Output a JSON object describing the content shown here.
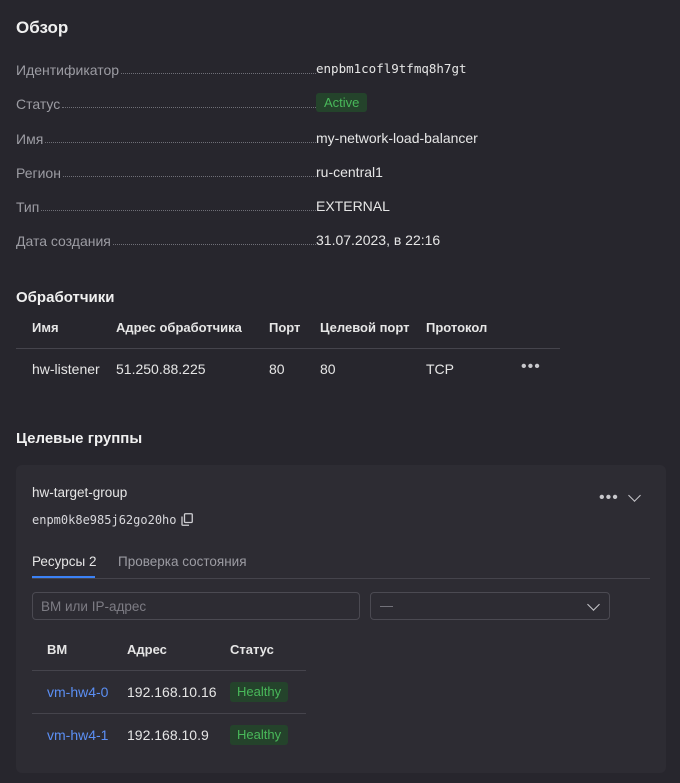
{
  "overview": {
    "title": "Обзор",
    "fields": [
      {
        "key": "Идентификатор",
        "value": "enpbm1cofl9tfmq8h7gt"
      },
      {
        "key": "Статус",
        "value": "Active"
      },
      {
        "key": "Имя",
        "value": "my-network-load-balancer"
      },
      {
        "key": "Регион",
        "value": "ru-central1"
      },
      {
        "key": "Тип",
        "value": "EXTERNAL"
      },
      {
        "key": "Дата создания",
        "value": "31.07.2023, в 22:16"
      }
    ]
  },
  "listeners": {
    "title": "Обработчики",
    "columns": [
      "Имя",
      "Адрес обработчика",
      "Порт",
      "Целевой порт",
      "Протокол"
    ],
    "rows": [
      {
        "name": "hw-listener",
        "address": "51.250.88.225",
        "port": "80",
        "target_port": "80",
        "protocol": "TCP"
      }
    ]
  },
  "target_groups": {
    "title": "Целевые группы",
    "group": {
      "name": "hw-target-group",
      "id": "enpm0k8e985j62go20ho",
      "tabs": [
        {
          "label": "Ресурсы 2",
          "active": true
        },
        {
          "label": "Проверка состояния",
          "active": false
        }
      ],
      "search_placeholder": "ВМ или IP-адрес",
      "status_filter": "—",
      "columns": [
        "ВМ",
        "Адрес",
        "Статус"
      ],
      "rows": [
        {
          "vm": "vm-hw4-0",
          "address": "192.168.10.16",
          "status": "Healthy"
        },
        {
          "vm": "vm-hw4-1",
          "address": "192.168.10.9",
          "status": "Healthy"
        }
      ]
    }
  },
  "colors": {
    "background": "#27262d",
    "panel": "#2d2c33",
    "accent": "#3b82f6",
    "link": "#5b8ff4",
    "healthy": "#49b85a"
  }
}
